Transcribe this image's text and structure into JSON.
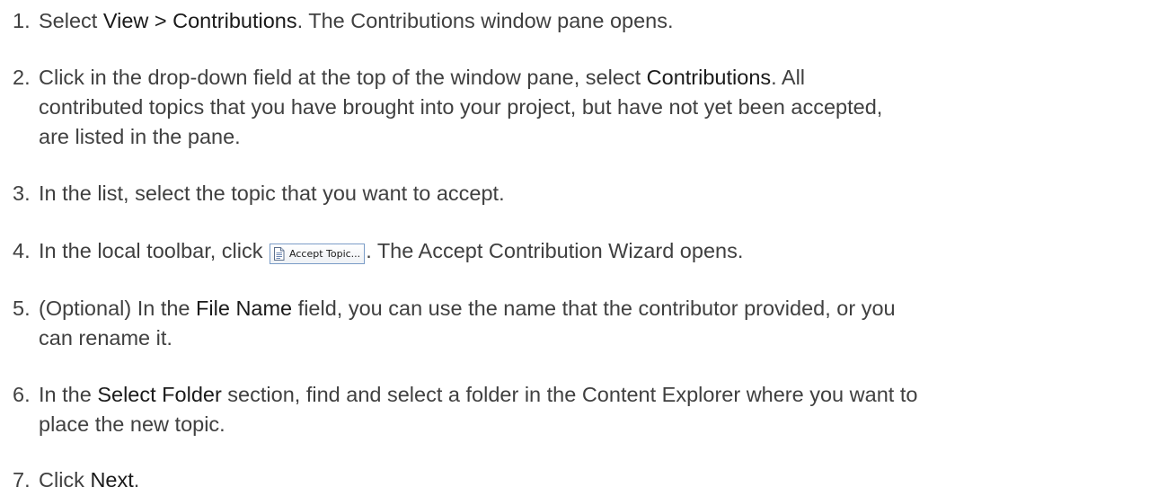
{
  "steps": [
    {
      "number": "1.",
      "parts": [
        {
          "text": "Select ",
          "bold": false
        },
        {
          "text": "View > Contributions",
          "bold": true
        },
        {
          "text": ". The Contributions window pane opens.",
          "bold": false
        }
      ]
    },
    {
      "number": "2.",
      "lines": [
        [
          {
            "text": "Click in the drop-down field at the top of the window pane, select ",
            "bold": false
          },
          {
            "text": "Contributions",
            "bold": true
          },
          {
            "text": ". All",
            "bold": false
          }
        ],
        [
          {
            "text": "contributed topics that you have brought into your project, but have not yet been accepted,",
            "bold": false
          }
        ],
        [
          {
            "text": "are listed in the pane.",
            "bold": false
          }
        ]
      ]
    },
    {
      "number": "3.",
      "parts": [
        {
          "text": "In the list, select the topic that you want to accept.",
          "bold": false
        }
      ]
    },
    {
      "number": "4.",
      "before_button": "In the local toolbar, click ",
      "button_label": "Accept Topic...",
      "button_icon": "document-icon",
      "after_button": ". The Accept Contribution Wizard opens."
    },
    {
      "number": "5.",
      "lines": [
        [
          {
            "text": "(Optional) In the ",
            "bold": false
          },
          {
            "text": "File Name",
            "bold": true
          },
          {
            "text": " field, you can use the name that the contributor provided, or you",
            "bold": false
          }
        ],
        [
          {
            "text": "can rename it.",
            "bold": false
          }
        ]
      ]
    },
    {
      "number": "6.",
      "lines": [
        [
          {
            "text": "In the ",
            "bold": false
          },
          {
            "text": "Select Folder",
            "bold": true
          },
          {
            "text": " section, find and select a folder in the Content Explorer where you want to",
            "bold": false
          }
        ],
        [
          {
            "text": "place the new topic.",
            "bold": false
          }
        ]
      ]
    },
    {
      "number": "7.",
      "parts": [
        {
          "text": "Click ",
          "bold": false
        },
        {
          "text": "Next",
          "bold": true
        },
        {
          "text": ".",
          "bold": false
        }
      ]
    }
  ],
  "colors": {
    "text": "#404040",
    "emphasis": "#1a1a1a",
    "button_border": "#7a9cc7"
  }
}
